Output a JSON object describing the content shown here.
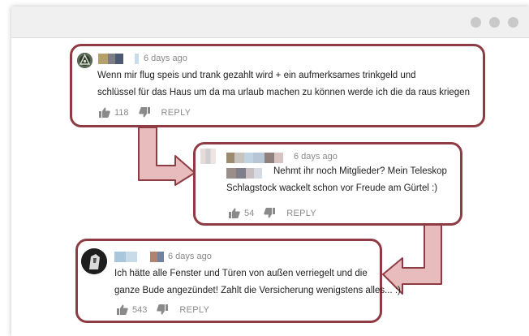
{
  "window": {
    "controls": [
      "window-dot",
      "window-dot",
      "window-dot"
    ]
  },
  "comments": [
    {
      "time": "6 days ago",
      "lines": [
        "Wenn mir flug speis und trank gezahlt wird + ein aufmerksames trinkgeld und",
        "schlüssel für das Haus um da ma urlaub  machen zu können werde ich die da raus kriegen"
      ],
      "likes": "118",
      "reply_label": "REPLY"
    },
    {
      "time": "6 days ago",
      "lines": [
        "Nehmt ihr noch Mitglieder? Mein Teleskop",
        "Schlagstock wackelt schon vor Freude am Gürtel :)"
      ],
      "likes": "54",
      "reply_label": "REPLY"
    },
    {
      "time": "6 days ago",
      "lines": [
        "Ich hätte alle Fenster und Türen von außen verriegelt und die",
        "ganze Bude angezündet! Zahlt die Versicherung wenigstens alles... :)"
      ],
      "likes": "543",
      "reply_label": "REPLY"
    }
  ],
  "icons": {
    "like": "thumbs-up-icon",
    "dislike": "thumbs-down-icon"
  },
  "colors": {
    "bubble_border": "#8e3b43",
    "arrow_fill": "#e8bcbc",
    "arrow_stroke": "#8e3b43"
  }
}
